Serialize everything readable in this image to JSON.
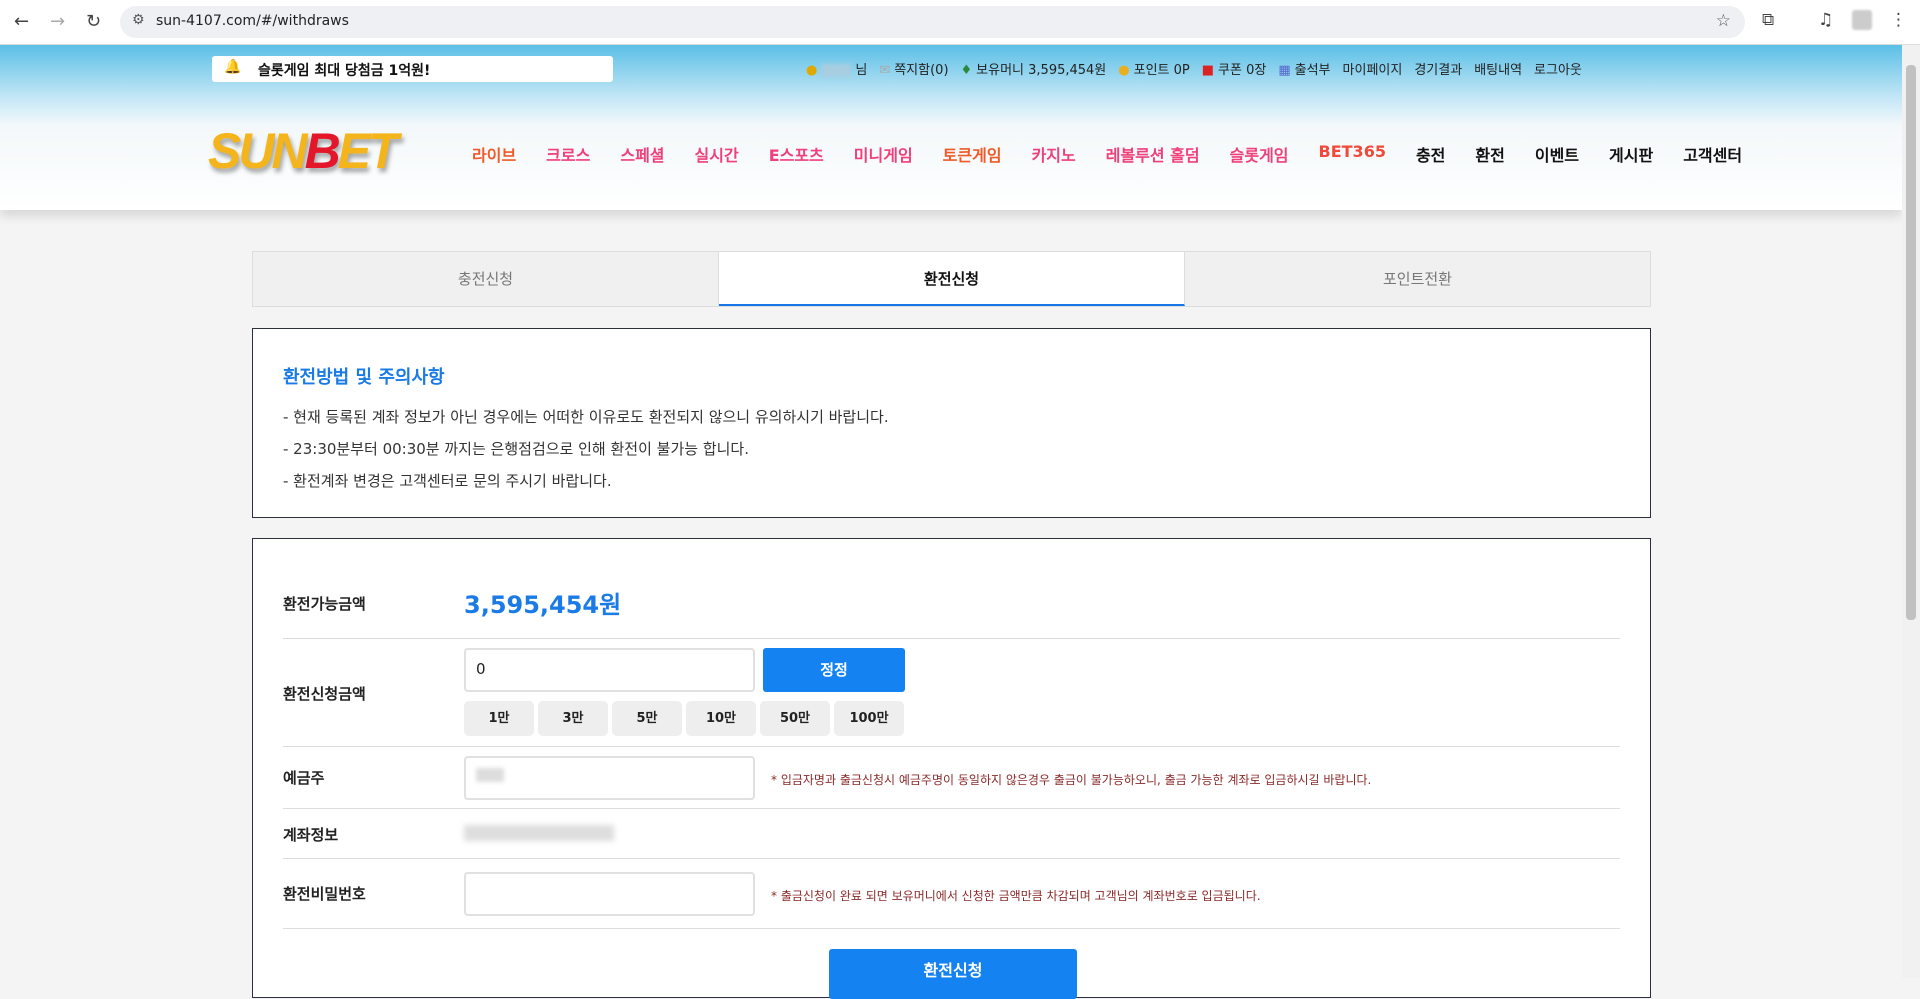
{
  "browser": {
    "url": "sun-4107.com/#/withdraws"
  },
  "header": {
    "notice": "슬롯게임 최대 당첨금 1억원!",
    "user_suffix": "님",
    "top_menu": [
      "쪽지함(0)",
      "보유머니 3,595,454원",
      "포인트 0P",
      "쿠폰 0장",
      "출석부",
      "마이페이지",
      "경기결과",
      "배팅내역",
      "로그아웃"
    ],
    "logo": "SUNBET",
    "nav": [
      {
        "label": "라이브",
        "color": "#f05a28"
      },
      {
        "label": "크로스",
        "color": "#f0407a"
      },
      {
        "label": "스페셜",
        "color": "#f0407a"
      },
      {
        "label": "실시간",
        "color": "#f0407a"
      },
      {
        "label": "E스포츠",
        "color": "#f0407a"
      },
      {
        "label": "미니게임",
        "color": "#f0407a"
      },
      {
        "label": "토큰게임",
        "color": "#f05a28"
      },
      {
        "label": "카지노",
        "color": "#f0407a"
      },
      {
        "label": "레볼루션 홀덤",
        "color": "#f0407a"
      },
      {
        "label": "슬롯게임",
        "color": "#f0407a"
      },
      {
        "label": "BET365",
        "color": "#f04a3a"
      },
      {
        "label": "충전",
        "color": "#111"
      },
      {
        "label": "환전",
        "color": "#111"
      },
      {
        "label": "이벤트",
        "color": "#111"
      },
      {
        "label": "게시판",
        "color": "#111"
      },
      {
        "label": "고객센터",
        "color": "#111"
      }
    ]
  },
  "tabs": [
    "충전신청",
    "환전신청",
    "포인트전환"
  ],
  "info": {
    "title": "환전방법 및 주의사항",
    "lines": [
      "- 현재 등록된 계좌 정보가 아닌 경우에는 어떠한 이유로도 환전되지 않으니 유의하시기 바랍니다.",
      "- 23:30분부터 00:30분 까지는 은행점검으로 인해 환전이 불가능 합니다.",
      "- 환전계좌 변경은 고객센터로 문의 주시기 바랍니다."
    ]
  },
  "form": {
    "available_label": "환전가능금액",
    "available_value": "3,595,454원",
    "amount_label": "환전신청금액",
    "amount_value": "0",
    "reset_label": "정정",
    "quick": [
      "1만",
      "3만",
      "5만",
      "10만",
      "50만",
      "100만"
    ],
    "holder_label": "예금주",
    "holder_hint": "* 입금자명과 출금신청시 예금주명이 동일하지 않은경우 출금이 불가능하오니, 출금 가능한 계좌로 입금하시길 바랍니다.",
    "account_label": "계좌정보",
    "password_label": "환전비밀번호",
    "password_hint": "* 출금신청이 완료 되면 보유머니에서 신청한 금액만큼 차감되며 고객님의 계좌번호로 입금됩니다.",
    "submit_label": "환전신청"
  }
}
